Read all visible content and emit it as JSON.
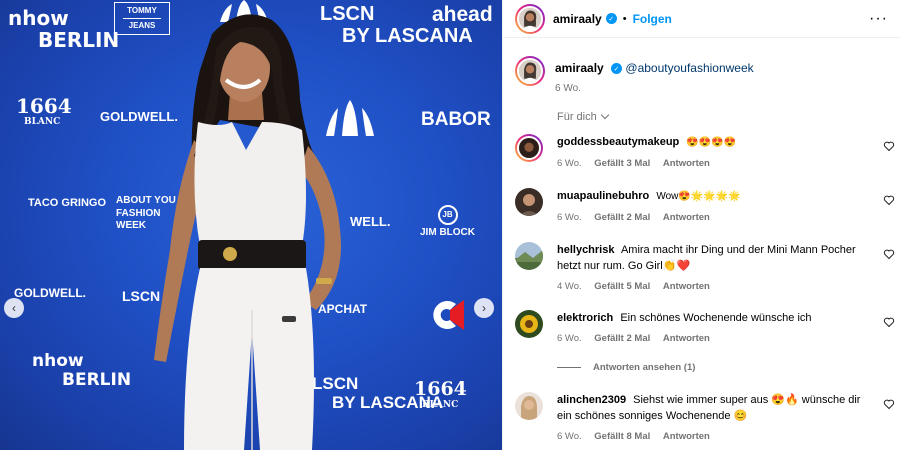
{
  "media": {
    "sponsors": [
      {
        "id": "nhow-top",
        "text": "nhow",
        "sub": "BERLIN"
      },
      {
        "id": "tommy-top",
        "text": "TOMMY",
        "sub": "JEANS"
      },
      {
        "id": "lscn-top",
        "text": "LSCN",
        "sub": "BY LASCANA"
      },
      {
        "id": "ahead-top",
        "text": "ahead"
      },
      {
        "id": "1664-left",
        "text": "1664",
        "sub": "BLANC"
      },
      {
        "id": "goldwell-left",
        "text": "GOLDWELL."
      },
      {
        "id": "babor",
        "text": "BABOR"
      },
      {
        "id": "tacogringo",
        "text": "TACO GRINGO"
      },
      {
        "id": "aboutyou",
        "text": "ABOUT YOU",
        "sub": "FASHION WEEK"
      },
      {
        "id": "goldwell-right",
        "text": "WELL."
      },
      {
        "id": "jimblock",
        "text": "JIM BLOCK"
      },
      {
        "id": "goldwell-left2",
        "text": "GOLDWELL."
      },
      {
        "id": "lscn-mid",
        "text": "LSCN"
      },
      {
        "id": "snapchat",
        "text": "APCHAT"
      },
      {
        "id": "nhow-bottom",
        "text": "nhow",
        "sub": "BERLIN"
      },
      {
        "id": "lscn-bottom",
        "text": "LSCN",
        "sub": "BY LASCANA"
      },
      {
        "id": "1664-right",
        "text": "1664",
        "sub": "BLANC"
      }
    ],
    "prev_icon": "chevron-left-icon",
    "next_icon": "chevron-right-icon",
    "background_color": "#1f4fc4"
  },
  "header": {
    "username": "amiraaly",
    "separator": "•",
    "follow_label": "Folgen",
    "more_label": "···"
  },
  "caption": {
    "username": "amiraaly",
    "mention": "@aboutyoufashionweek",
    "time": "6 Wo."
  },
  "filter": {
    "label": "Für dich"
  },
  "comments": [
    {
      "username": "goddessbeautymakeup",
      "text": "😍😍😍😍",
      "time": "6 Wo.",
      "likes": "Gefällt 3 Mal",
      "reply": "Antworten"
    },
    {
      "username": "muapaulinebuhro",
      "text": "Wow😍🌟🌟🌟🌟",
      "time": "6 Wo.",
      "likes": "Gefällt 2 Mal",
      "reply": "Antworten"
    },
    {
      "username": "hellychrisk",
      "text": "Amira macht ihr Ding und der Mini Mann Pocher hetzt nur rum. Go Girl👏❤️",
      "time": "4 Wo.",
      "likes": "Gefällt 5 Mal",
      "reply": "Antworten"
    },
    {
      "username": "elektrorich",
      "text": "Ein schönes Wochenende wünsche ich",
      "time": "6 Wo.",
      "likes": "Gefällt 2 Mal",
      "reply": "Antworten"
    },
    {
      "username": "alinchen2309",
      "text": "Siehst wie immer super aus 😍🔥 wünsche dir ein schönes sonniges Wochenende 😊",
      "time": "6 Wo.",
      "likes": "Gefällt 8 Mal",
      "reply": "Antworten"
    }
  ],
  "view_replies": "Antworten ansehen (1)",
  "colors": {
    "accent": "#0095f6",
    "muted": "#737373",
    "mention": "#00376b"
  }
}
